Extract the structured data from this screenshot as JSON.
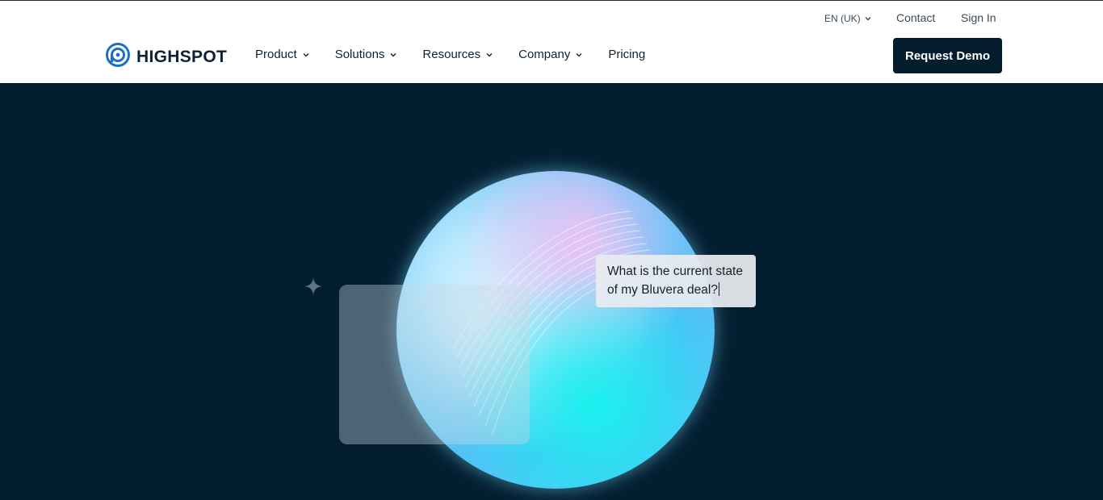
{
  "brand": {
    "name": "HIGHSPOT",
    "accent": "#1e6fc4"
  },
  "utility": {
    "language": "EN (UK)",
    "contact": "Contact",
    "sign_in": "Sign In"
  },
  "nav": {
    "items": [
      {
        "label": "Product",
        "has_menu": true
      },
      {
        "label": "Solutions",
        "has_menu": true
      },
      {
        "label": "Resources",
        "has_menu": true
      },
      {
        "label": "Company",
        "has_menu": true
      },
      {
        "label": "Pricing",
        "has_menu": false
      }
    ]
  },
  "cta": {
    "label": "Request Demo"
  },
  "hero": {
    "background": "#041e31",
    "prompt_line1": "What is the current state",
    "prompt_line2": "of my Bluvera deal?"
  }
}
